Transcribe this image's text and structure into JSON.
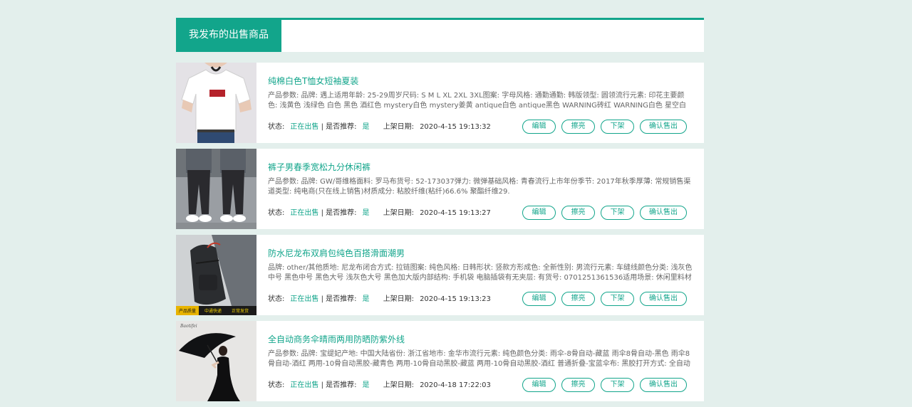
{
  "header": {
    "tab_label": "我发布的出售商品"
  },
  "labels": {
    "status": "状态:",
    "separator": "|",
    "recommend": "是否推荐:",
    "date": "上架日期:"
  },
  "buttons": {
    "edit": "编辑",
    "polish": "擦亮",
    "off_shelf": "下架",
    "confirm_sold": "确认售出"
  },
  "items": [
    {
      "title": "纯棉白色T恤女短袖夏装",
      "params": "产品参数: 品牌: 遇上适用年龄: 25-29周岁尺码: S M L XL 2XL 3XL图案: 字母风格: 通勤通勤: 韩版领型: 圆领流行元素: 印花主要颜色: 浅黄色 浅绿色 白色 黑色 酒红色 mystery白色 mystery姜黄 antique白色 antique黑色 WARNING砖红 WARNING白色 星空白色 火烈鸟白色",
      "status": "正在出售",
      "recommend": "是",
      "date": "2020-4-15 19:13:32"
    },
    {
      "title": "裤子男春季宽松九分休闲裤",
      "params": "产品参数: 品牌: GW/哥维格面料: 罗马布货号: 52-173037弹力: 微弹基础风格: 青春流行上市年份季节: 2017年秋季厚薄: 常规销售渠道类型: 纯电商(只在线上销售)材质成分: 粘胶纤维(粘纤)66.6% 聚酯纤维29.",
      "status": "正在出售",
      "recommend": "是",
      "date": "2020-4-15 19:13:27"
    },
    {
      "title": "防水尼龙布双肩包纯色百搭滑面潮男",
      "params": "品牌: other/其他质地: 尼龙布闭合方式: 拉链图案: 纯色风格: 日韩形状: 竖款方形成色: 全新性别: 男流行元素: 车缝线颜色分类: 浅灰色中号 黑色中号 黑色大号 浅灰色大号 黑色加大版内部结构: 手机袋 电脑插袋有无夹层: 有货号: 0701251361536适用场景: 休闲里料材质: 腈纶肩带样",
      "status": "正在出售",
      "recommend": "是",
      "date": "2020-4-15 19:13:23",
      "image_caption_left": "产品质量",
      "image_caption_mid": "中通快递",
      "image_caption_right": "正常发货"
    },
    {
      "title": "全自动商务伞晴雨两用防晒防紫外线",
      "params": "产品参数: 品牌: 宝缇妃产地: 中国大陆省份: 浙江省地市: 金华市流行元素: 纯色颜色分类: 雨伞-8骨自动-藏蓝 雨伞8骨自动-黑色 雨伞8骨自动-酒红 两用-10骨自动黑胶-藏青色 两用-10骨自动黑胶-藏蓝 两用-10骨自动黑胶-酒红 普通折叠-宝蓝伞布: 黑胶打开方式: 全自动货号: A-",
      "status": "正在出售",
      "recommend": "是",
      "date": "2020-4-18 17:22:03",
      "image_logo": "Baotifei"
    }
  ]
}
